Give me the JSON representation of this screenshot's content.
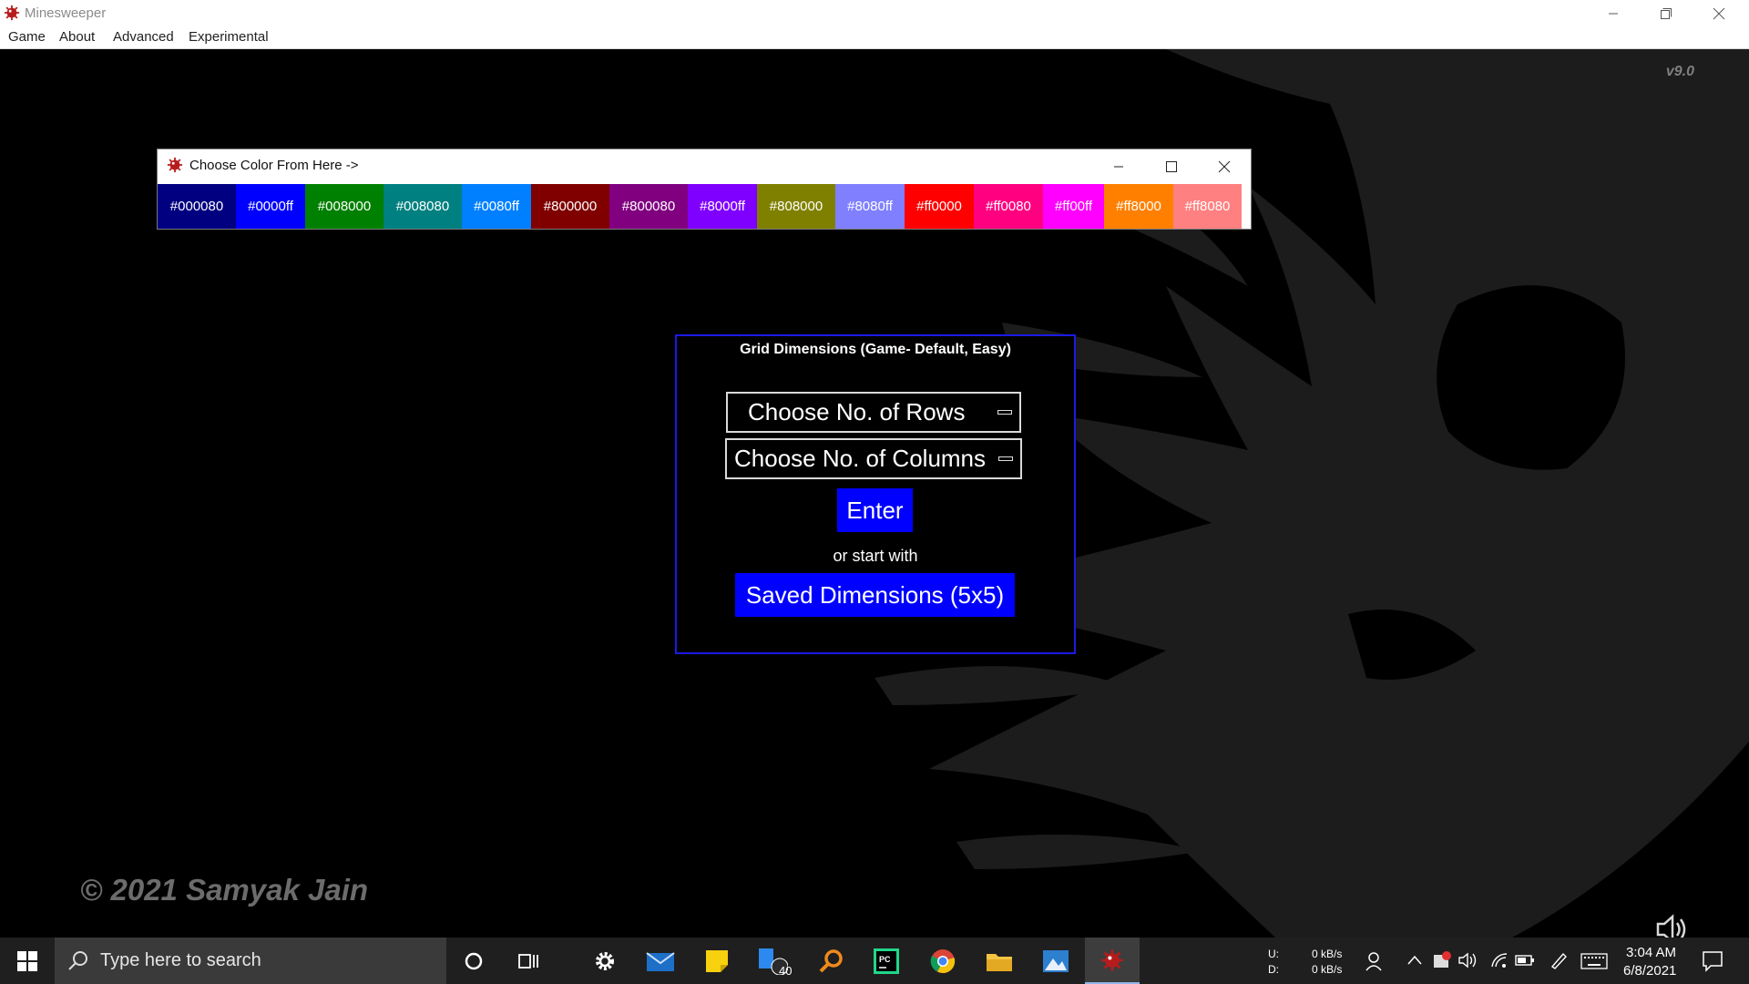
{
  "window": {
    "title": "Minesweeper"
  },
  "menu": {
    "items": [
      "Game",
      "About",
      "Advanced",
      "Experimental"
    ]
  },
  "version": "v9.0",
  "color_window": {
    "title": "Choose Color From Here ->",
    "swatches": [
      {
        "label": "#000080",
        "color": "#000080"
      },
      {
        "label": "#0000ff",
        "color": "#0000ff"
      },
      {
        "label": "#008000",
        "color": "#008000"
      },
      {
        "label": "#008080",
        "color": "#008080"
      },
      {
        "label": "#0080ff",
        "color": "#0080ff"
      },
      {
        "label": "#800000",
        "color": "#800000"
      },
      {
        "label": "#800080",
        "color": "#800080"
      },
      {
        "label": "#8000ff",
        "color": "#8000ff"
      },
      {
        "label": "#808000",
        "color": "#808000"
      },
      {
        "label": "#8080ff",
        "color": "#8080ff"
      },
      {
        "label": "#ff0000",
        "color": "#ff0000"
      },
      {
        "label": "#ff0080",
        "color": "#ff0080"
      },
      {
        "label": "#ff00ff",
        "color": "#ff00ff"
      },
      {
        "label": "#ff8000",
        "color": "#ff8000"
      },
      {
        "label": "#ff8080",
        "color": "#ff8080"
      }
    ]
  },
  "grid_panel": {
    "title": "Grid Dimensions (Game- Default, Easy)",
    "rows_placeholder": "Choose No. of Rows",
    "columns_placeholder": "Choose No. of Columns",
    "enter_label": "Enter",
    "or_text": "or start with",
    "saved_label": "Saved Dimensions (5x5)"
  },
  "copyright": "© 2021 Samyak Jain",
  "taskbar": {
    "search_placeholder": "Type here to search",
    "mail_badge": "40",
    "net_up_label": "U:",
    "net_down_label": "D:",
    "net_up": "0 kB/s",
    "net_down": "0 kB/s",
    "time": "3:04 AM",
    "date": "6/8/2021"
  },
  "colors": {
    "accent": "#0000ff",
    "panel_border": "#1a1ae6"
  }
}
